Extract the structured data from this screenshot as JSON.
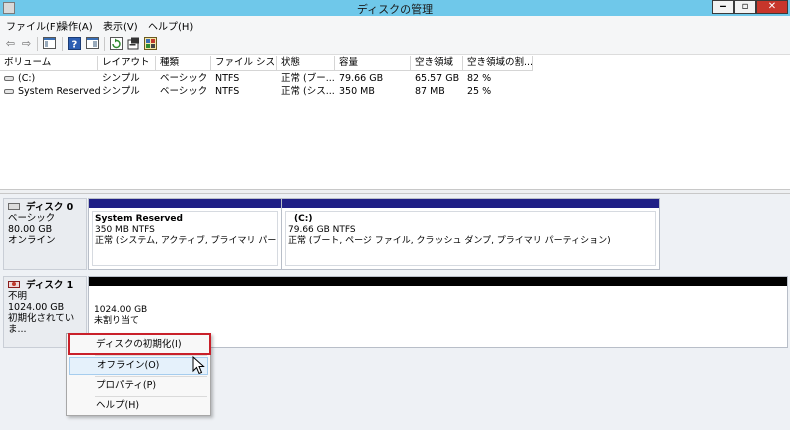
{
  "window": {
    "title": "ディスクの管理",
    "min_label": "‒",
    "max_label": "▫",
    "close_label": "✕"
  },
  "menu": [
    "ファイル(F)",
    "操作(A)",
    "表示(V)",
    "ヘルプ(H)"
  ],
  "toolbar": {
    "icons": [
      "back-icon",
      "forward-icon",
      "console-tree-icon",
      "help-icon",
      "action-pane-icon",
      "refresh-icon",
      "properties-icon",
      "settings-icon"
    ]
  },
  "volume_list": {
    "columns": [
      "ボリューム",
      "レイアウト",
      "種類",
      "ファイル シス...",
      "状態",
      "容量",
      "空き領域",
      "空き領域の割..."
    ],
    "rows": [
      [
        "(C:)",
        "シンプル",
        "ベーシック",
        "NTFS",
        "正常 (ブー...",
        "79.66 GB",
        "65.57 GB",
        "82 %"
      ],
      [
        "System Reserved",
        "シンプル",
        "ベーシック",
        "NTFS",
        "正常 (シス...",
        "350 MB",
        "87 MB",
        "25 %"
      ]
    ]
  },
  "disks": [
    {
      "name": "ディスク 0",
      "type": "ベーシック",
      "size": "80.00 GB",
      "status": "オンライン",
      "partitions": [
        {
          "name": "System Reserved",
          "size": "350 MB NTFS",
          "status": "正常 (システム, アクティブ, プライマリ パーティション"
        },
        {
          "name": "(C:)",
          "size": "79.66 GB NTFS",
          "status": "正常 (ブート, ページ ファイル, クラッシュ ダンプ, プライマリ パーティション)"
        }
      ]
    },
    {
      "name": "ディスク 1",
      "type": "不明",
      "size": "1024.00 GB",
      "status": "初期化されていま...",
      "partitions": [
        {
          "size": "1024.00 GB",
          "status": "未割り当て"
        }
      ]
    }
  ],
  "context_menu": {
    "items": [
      "ディスクの初期化(I)",
      "オフライン(O)",
      "プロパティ(P)",
      "ヘルプ(H)"
    ],
    "highlighted_index": 1,
    "outlined_index": 0
  },
  "colors": {
    "titlebar": "#6fc8ea",
    "primary_partition_bar": "#1f1f86",
    "unallocated_bar": "#000000",
    "close_button": "#c7362b",
    "annotation_outline": "#c9202a"
  }
}
